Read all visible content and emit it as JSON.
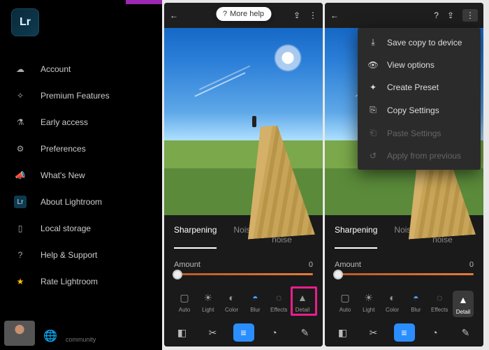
{
  "sidebar": {
    "logo_text": "Lr",
    "items": [
      {
        "label": "Account",
        "icon": "cloud-icon"
      },
      {
        "label": "Premium Features",
        "icon": "star-outline-icon"
      },
      {
        "label": "Early access",
        "icon": "flask-icon"
      },
      {
        "label": "Preferences",
        "icon": "gear-icon"
      },
      {
        "label": "What's New",
        "icon": "megaphone-icon"
      },
      {
        "label": "About Lightroom",
        "icon": "lr-badge-icon"
      },
      {
        "label": "Local storage",
        "icon": "sd-card-icon"
      },
      {
        "label": "Help & Support",
        "icon": "help-icon"
      },
      {
        "label": "Rate Lightroom",
        "icon": "star-filled-icon"
      }
    ],
    "footer_label": "community"
  },
  "phone1": {
    "help_pill": "More help",
    "tabs": {
      "sharpening": "Sharpening",
      "noise": "Noise",
      "color_noise": "Color noise"
    },
    "slider_label": "Amount",
    "slider_value": "0",
    "tools": [
      {
        "label": "Auto"
      },
      {
        "label": "Light"
      },
      {
        "label": "Color"
      },
      {
        "label": "Blur"
      },
      {
        "label": "Effects"
      },
      {
        "label": "Detail"
      }
    ]
  },
  "phone2": {
    "tabs": {
      "sharpening": "Sharpening",
      "noise": "Noise",
      "color_noise": "Color noise"
    },
    "slider_label": "Amount",
    "slider_value": "0",
    "tools": [
      {
        "label": "Auto"
      },
      {
        "label": "Light"
      },
      {
        "label": "Color"
      },
      {
        "label": "Blur"
      },
      {
        "label": "Effects"
      },
      {
        "label": "Detail"
      }
    ],
    "popup": [
      {
        "label": "Save copy to device",
        "enabled": true
      },
      {
        "label": "View options",
        "enabled": true
      },
      {
        "label": "Create Preset",
        "enabled": true
      },
      {
        "label": "Copy Settings",
        "enabled": true
      },
      {
        "label": "Paste Settings",
        "enabled": false
      },
      {
        "label": "Apply from previous",
        "enabled": false
      }
    ]
  }
}
